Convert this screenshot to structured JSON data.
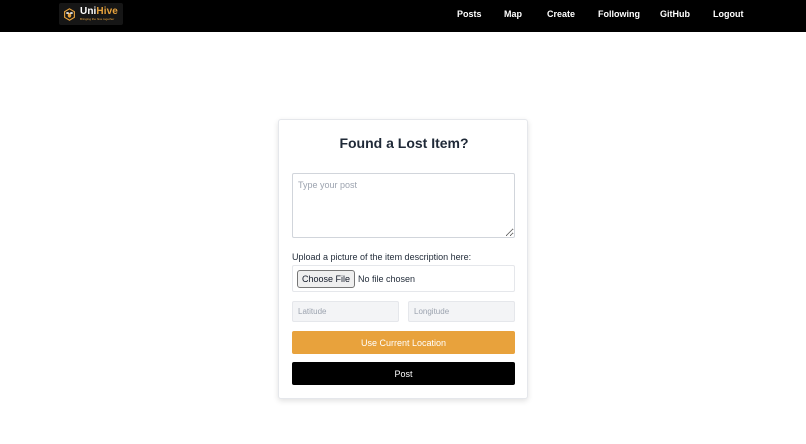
{
  "brand": {
    "name_part1": "Uni",
    "name_part2": "Hive",
    "tagline": "Bringing the hive together",
    "accent_color": "#e8a23c"
  },
  "nav": {
    "links": [
      {
        "label": "Posts"
      },
      {
        "label": "Map"
      },
      {
        "label": "Create"
      },
      {
        "label": "Following"
      },
      {
        "label": "GitHub"
      },
      {
        "label": "Logout"
      }
    ]
  },
  "form": {
    "title": "Found a Lost Item?",
    "post_placeholder": "Type your post",
    "upload_label": "Upload a picture of the item description here:",
    "file_button_label": "Choose File",
    "file_status": "No file chosen",
    "latitude_placeholder": "Latitude",
    "longitude_placeholder": "Longitude",
    "location_button_label": "Use Current Location",
    "submit_button_label": "Post"
  }
}
